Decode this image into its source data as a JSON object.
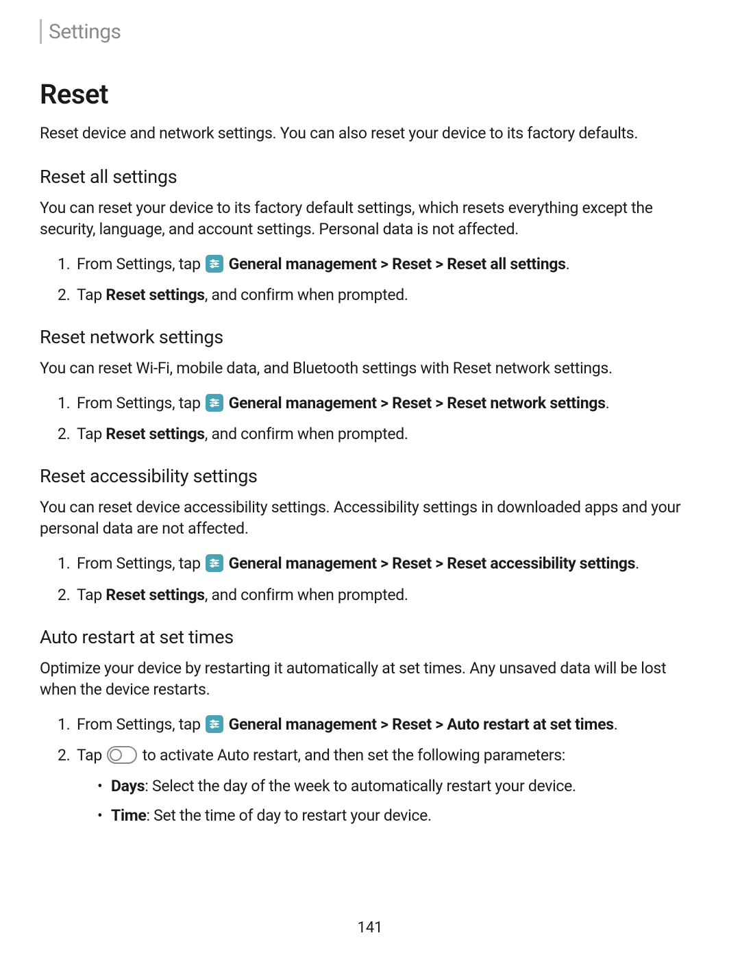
{
  "header": {
    "title": "Settings"
  },
  "main": {
    "title": "Reset",
    "intro": "Reset device and network settings. You can also reset your device to its factory defaults."
  },
  "sections": {
    "reset_all": {
      "title": "Reset all settings",
      "desc": "You can reset your device to its factory default settings, which resets everything except the security, language, and account settings. Personal data is not affected.",
      "step1_prefix": "From Settings, tap",
      "step1_path": " General management > Reset > Reset all settings",
      "step1_period": ".",
      "step2_prefix": "Tap ",
      "step2_bold": "Reset settings",
      "step2_suffix": ", and confirm when prompted."
    },
    "reset_network": {
      "title": "Reset network settings",
      "desc": "You can reset Wi-Fi, mobile data, and Bluetooth settings with Reset network settings.",
      "step1_prefix": "From Settings, tap",
      "step1_path": " General management > Reset > Reset network settings",
      "step1_period": ".",
      "step2_prefix": "Tap ",
      "step2_bold": "Reset settings",
      "step2_suffix": ", and confirm when prompted."
    },
    "reset_accessibility": {
      "title": "Reset accessibility settings",
      "desc": "You can reset device accessibility settings. Accessibility settings in downloaded apps and your personal data are not affected.",
      "step1_prefix": "From Settings, tap",
      "step1_path": " General management > Reset > Reset accessibility settings",
      "step1_period": ".",
      "step2_prefix": "Tap ",
      "step2_bold": "Reset settings",
      "step2_suffix": ", and confirm when prompted."
    },
    "auto_restart": {
      "title": "Auto restart at set times",
      "desc": "Optimize your device by restarting it automatically at set times. Any unsaved data will be lost when the device restarts.",
      "step1_prefix": "From Settings, tap",
      "step1_path": " General management > Reset > Auto restart at set times",
      "step1_period": ".",
      "step2_prefix": "Tap ",
      "step2_suffix": " to activate Auto restart, and then set the following parameters:",
      "bullets": {
        "days_label": "Days",
        "days_text": ": Select the day of the week to automatically restart your device.",
        "time_label": "Time",
        "time_text": ": Set the time of day to restart your device."
      }
    }
  },
  "page_number": "141"
}
